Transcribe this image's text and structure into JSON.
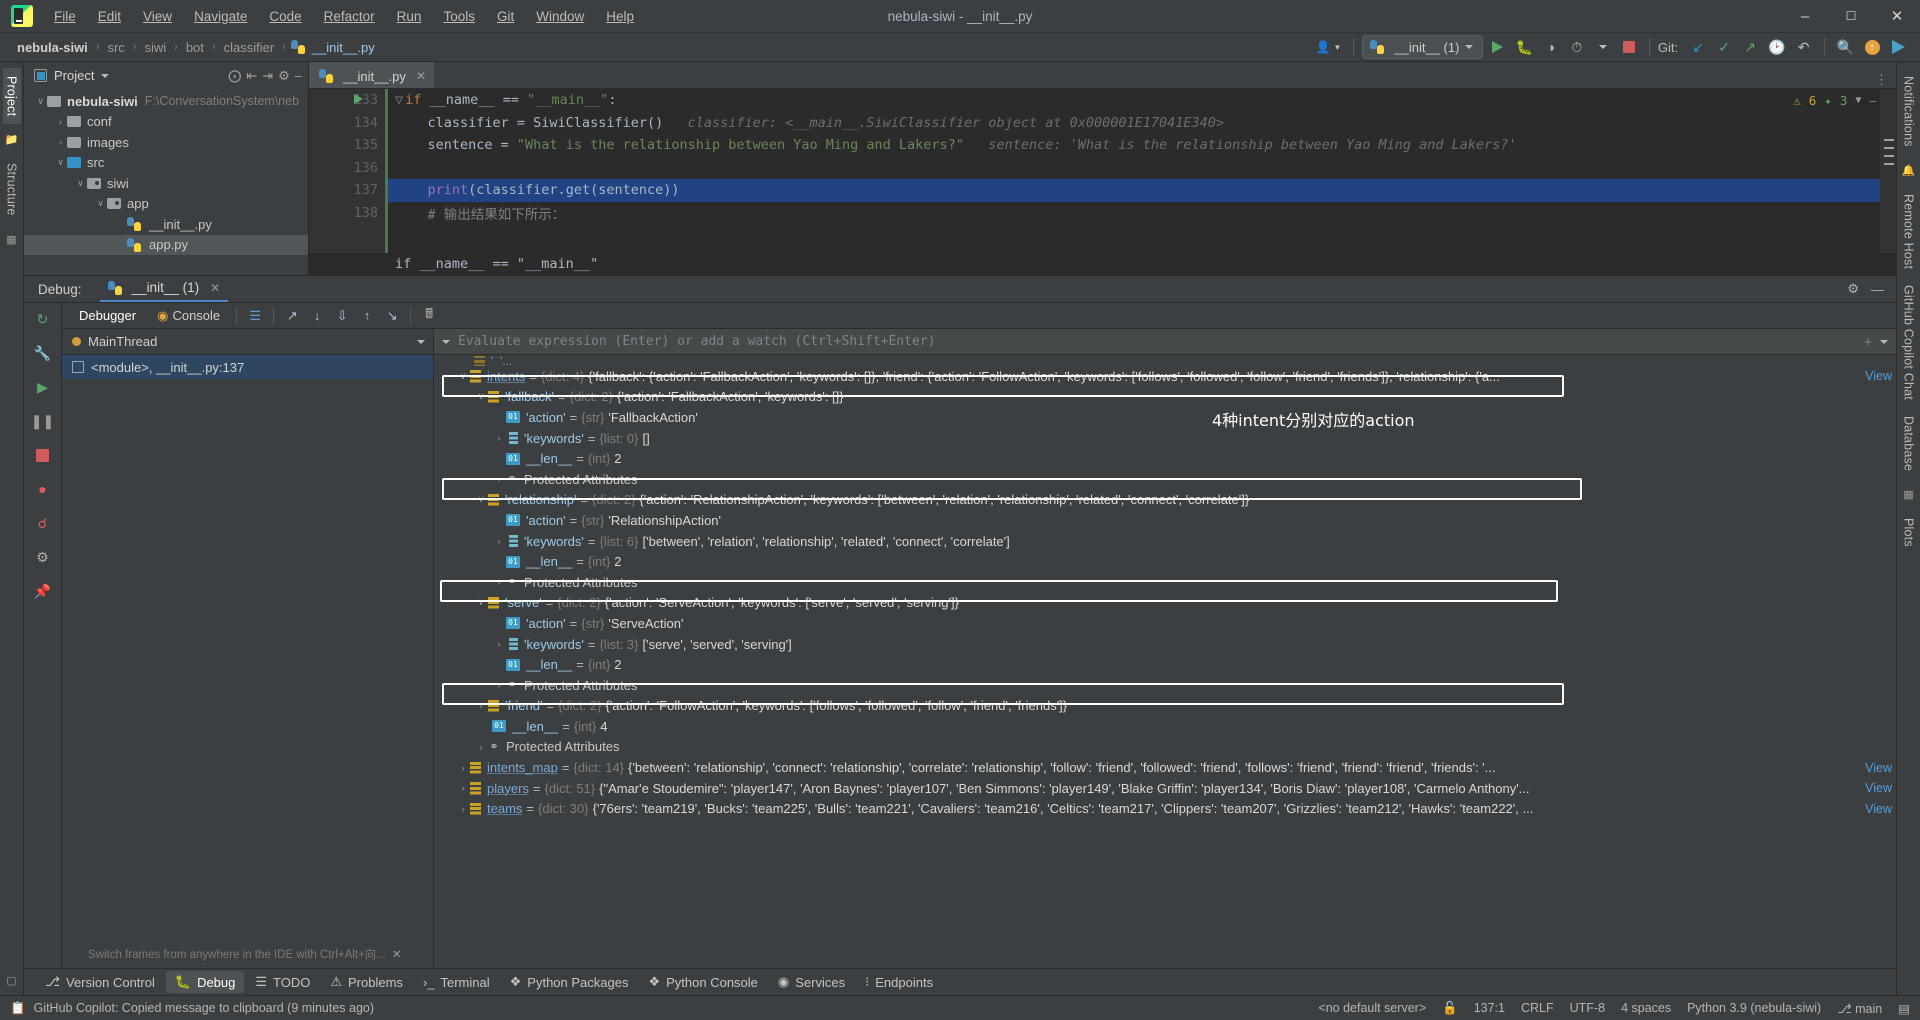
{
  "window": {
    "title": "nebula-siwi - __init__.py",
    "controls": {
      "minimize": "–",
      "maximize": "❐",
      "close": "✕"
    }
  },
  "menubar": {
    "items": [
      "File",
      "Edit",
      "View",
      "Navigate",
      "Code",
      "Refactor",
      "Run",
      "Tools",
      "Git",
      "Window",
      "Help"
    ]
  },
  "breadcrumbs": {
    "items": [
      "nebula-siwi",
      "src",
      "siwi",
      "bot",
      "classifier",
      "__init__.py"
    ],
    "separator": "›"
  },
  "toolbar": {
    "run_config": "__init__ (1)",
    "git_label": "Git:",
    "icons": [
      "account-icon",
      "run-icon",
      "debug-icon",
      "coverage-icon",
      "profile-icon",
      "stop-icon",
      "git-update-icon",
      "git-commit-icon",
      "git-push-icon",
      "git-history-icon",
      "git-rollback-icon",
      "search-icon",
      "updates-icon",
      "copilot-icon"
    ]
  },
  "project_panel": {
    "title": "Project",
    "tree": [
      {
        "indent": 0,
        "twist": "∨",
        "icon": "folder-gray",
        "label": "nebula-siwi",
        "bold": true,
        "path": "F:\\ConversationSystem\\neb"
      },
      {
        "indent": 1,
        "twist": "›",
        "icon": "folder-gray",
        "label": "conf",
        "bold": false,
        "path": ""
      },
      {
        "indent": 1,
        "twist": "›",
        "icon": "folder-gray",
        "label": "images",
        "bold": false,
        "path": ""
      },
      {
        "indent": 1,
        "twist": "∨",
        "icon": "folder-blue",
        "label": "src",
        "bold": false,
        "path": ""
      },
      {
        "indent": 2,
        "twist": "∨",
        "icon": "folder-pkg",
        "label": "siwi",
        "bold": false,
        "path": ""
      },
      {
        "indent": 3,
        "twist": "∨",
        "icon": "folder-pkg",
        "label": "app",
        "bold": false,
        "path": ""
      },
      {
        "indent": 4,
        "twist": "",
        "icon": "python-file",
        "label": "__init__.py",
        "bold": false,
        "path": ""
      },
      {
        "indent": 4,
        "twist": "",
        "icon": "python-file",
        "label": "app.py",
        "bold": false,
        "path": ""
      }
    ]
  },
  "editor": {
    "tab": "__init__.py",
    "inspection": {
      "warnings": "6",
      "weak_warnings": "3"
    },
    "lines": [
      {
        "num": "133",
        "marker": "run-arrow",
        "segments": [
          {
            "t": "if ",
            "c": "kw"
          },
          {
            "t": "__name__ ",
            "c": "pl"
          },
          {
            "t": "== ",
            "c": "pl"
          },
          {
            "t": "\"__main__\"",
            "c": "str"
          },
          {
            "t": ":",
            "c": "pl"
          }
        ]
      },
      {
        "num": "134",
        "marker": "",
        "segments": [
          {
            "t": "    classifier = SiwiClassifier()",
            "c": "pl"
          },
          {
            "t": "   classifier: <__main__.SiwiClassifier object at 0x000001E17041E340>",
            "c": "inl"
          }
        ]
      },
      {
        "num": "135",
        "marker": "",
        "segments": [
          {
            "t": "    sentence = ",
            "c": "pl"
          },
          {
            "t": "\"What is the relationship between Yao Ming and Lakers?\"",
            "c": "str"
          },
          {
            "t": "   sentence: 'What is the relationship between Yao Ming and Lakers?'",
            "c": "inl"
          }
        ]
      },
      {
        "num": "136",
        "marker": "",
        "segments": [
          {
            "t": "",
            "c": "pl"
          }
        ]
      },
      {
        "num": "137",
        "marker": "breakpoint",
        "highlight": true,
        "segments": [
          {
            "t": "    ",
            "c": "pl"
          },
          {
            "t": "print",
            "c": "vi"
          },
          {
            "t": "(classifier.get(sentence))",
            "c": "pl"
          }
        ]
      },
      {
        "num": "138",
        "marker": "",
        "segments": [
          {
            "t": "    # 输出结果如下所示：",
            "c": "cmt"
          }
        ]
      }
    ],
    "collapsed_preview": "if __name__ == \"__main__\""
  },
  "debug": {
    "header_label": "Debug:",
    "session_tab": "__init__ (1)",
    "tabs": [
      {
        "label": "Debugger",
        "active": true
      },
      {
        "label": "Console",
        "active": false
      }
    ],
    "thread": "MainThread",
    "frame": "<module>, __init__.py:137",
    "frames_hint": "Switch frames from anywhere in the IDE with Ctrl+Alt+向...",
    "watch_placeholder": "Evaluate expression (Enter) or add a watch (Ctrl+Shift+Enter)",
    "annotation": "4种intent分别对应的action",
    "view_label": "View",
    "variables": [
      {
        "indent": 0,
        "twist": "",
        "icon": "dict-icon",
        "name": "",
        "type": "",
        "value": "",
        "partial": true,
        "hidden": true
      },
      {
        "indent": 1,
        "twist": "∨",
        "icon": "dict-icon",
        "name": "intents",
        "underline": true,
        "type": "{dict: 4}",
        "value": "{'fallback': {'action': 'FallbackAction', 'keywords': []}, 'friend': {'action': 'FollowAction', 'keywords': ['follows', 'followed', 'follow', 'friend', 'friends']}, 'relationship': {'a...",
        "view": true
      },
      {
        "indent": 2,
        "twist": "∨",
        "icon": "dict-icon",
        "name": "'fallback'",
        "type": "{dict: 2}",
        "value": "{'action': 'FallbackAction', 'keywords': []}",
        "boxed": true
      },
      {
        "indent": 3,
        "twist": "",
        "icon": "str-icon",
        "name": "'action'",
        "type": "{str}",
        "value": "'FallbackAction'"
      },
      {
        "indent": 3,
        "twist": "›",
        "icon": "list-icon",
        "name": "'keywords'",
        "type": "{list: 0}",
        "value": "[]"
      },
      {
        "indent": 3,
        "twist": "",
        "icon": "str-icon",
        "name": "__len__",
        "type": "{int}",
        "value": "2"
      },
      {
        "indent": 3,
        "twist": "›",
        "icon": "protected-icon",
        "name": "",
        "plain": "Protected Attributes"
      },
      {
        "indent": 2,
        "twist": "∨",
        "icon": "dict-icon",
        "name": "'relationship'",
        "type": "{dict: 2}",
        "value": "{'action': 'RelationshipAction', 'keywords': ['between', 'relation', 'relationship', 'related', 'connect', 'correlate']}",
        "boxed": true
      },
      {
        "indent": 3,
        "twist": "",
        "icon": "str-icon",
        "name": "'action'",
        "type": "{str}",
        "value": "'RelationshipAction'"
      },
      {
        "indent": 3,
        "twist": "›",
        "icon": "list-icon",
        "name": "'keywords'",
        "type": "{list: 6}",
        "value": "['between', 'relation', 'relationship', 'related', 'connect', 'correlate']"
      },
      {
        "indent": 3,
        "twist": "",
        "icon": "str-icon",
        "name": "__len__",
        "type": "{int}",
        "value": "2"
      },
      {
        "indent": 3,
        "twist": "›",
        "icon": "protected-icon",
        "name": "",
        "plain": "Protected Attributes"
      },
      {
        "indent": 2,
        "twist": "∨",
        "icon": "dict-icon",
        "name": "'serve'",
        "type": "{dict: 2}",
        "value": "{'action': 'ServeAction', 'keywords': ['serve', 'served', 'serving']}",
        "boxed": true
      },
      {
        "indent": 3,
        "twist": "",
        "icon": "str-icon",
        "name": "'action'",
        "type": "{str}",
        "value": "'ServeAction'"
      },
      {
        "indent": 3,
        "twist": "›",
        "icon": "list-icon",
        "name": "'keywords'",
        "type": "{list: 3}",
        "value": "['serve', 'served', 'serving']"
      },
      {
        "indent": 3,
        "twist": "",
        "icon": "str-icon",
        "name": "__len__",
        "type": "{int}",
        "value": "2"
      },
      {
        "indent": 3,
        "twist": "›",
        "icon": "protected-icon",
        "name": "",
        "plain": "Protected Attributes"
      },
      {
        "indent": 2,
        "twist": "›",
        "icon": "dict-icon",
        "name": "'friend'",
        "type": "{dict: 2}",
        "value": "{'action': 'FollowAction', 'keywords': ['follows', 'followed', 'follow', 'friend', 'friends']}",
        "boxed": true
      },
      {
        "indent": 3,
        "twist": "",
        "icon": "str-icon",
        "name": "__len__",
        "type": "{int}",
        "value": "4"
      },
      {
        "indent": 2,
        "twist": "›",
        "icon": "protected-icon",
        "name": "",
        "plain": "Protected Attributes"
      },
      {
        "indent": 1,
        "twist": "›",
        "icon": "dict-icon",
        "name": "intents_map",
        "underline": true,
        "type": "{dict: 14}",
        "value": "{'between': 'relationship', 'connect': 'relationship', 'correlate': 'relationship', 'follow': 'friend', 'followed': 'friend', 'follows': 'friend', 'friend': 'friend', 'friends': '...",
        "view": true
      },
      {
        "indent": 1,
        "twist": "›",
        "icon": "dict-icon",
        "name": "players",
        "underline": true,
        "type": "{dict: 51}",
        "value": "{\"Amar'e Stoudemire\": 'player147', 'Aron Baynes': 'player107', 'Ben Simmons': 'player149', 'Blake Griffin': 'player134', 'Boris Diaw': 'player108', 'Carmelo Anthony'...",
        "view": true
      },
      {
        "indent": 1,
        "twist": "›",
        "icon": "dict-icon",
        "name": "teams",
        "underline": true,
        "type": "{dict: 30}",
        "value": "{'76ers': 'team219', 'Bucks': 'team225', 'Bulls': 'team221', 'Cavaliers': 'team216', 'Celtics': 'team217', 'Clippers': 'team207', 'Grizzlies': 'team212', 'Hawks': 'team222', ...",
        "view": true
      }
    ]
  },
  "left_rail": {
    "items": [
      "Project",
      "Structure"
    ]
  },
  "right_rail": {
    "items": [
      "Notifications",
      "Remote Host",
      "GitHub Copilot Chat",
      "Database",
      "Plots"
    ]
  },
  "toolwindow_bar": {
    "items": [
      {
        "label": "Version Control",
        "icon": "branch-icon",
        "active": false
      },
      {
        "label": "Debug",
        "icon": "debug-icon",
        "active": true
      },
      {
        "label": "TODO",
        "icon": "todo-icon",
        "active": false
      },
      {
        "label": "Problems",
        "icon": "problems-icon",
        "active": false
      },
      {
        "label": "Terminal",
        "icon": "terminal-icon",
        "active": false
      },
      {
        "label": "Python Packages",
        "icon": "packages-icon",
        "active": false
      },
      {
        "label": "Python Console",
        "icon": "console-icon",
        "active": false
      },
      {
        "label": "Services",
        "icon": "services-icon",
        "active": false
      },
      {
        "label": "Endpoints",
        "icon": "endpoints-icon",
        "active": false
      }
    ]
  },
  "statusbar": {
    "message": "GitHub Copilot: Copied message to clipboard (9 minutes ago)",
    "right": [
      "<no default server>",
      "137:1",
      "CRLF",
      "UTF-8",
      "4 spaces",
      "Python 3.9 (nebula-siwi)",
      "main"
    ]
  }
}
